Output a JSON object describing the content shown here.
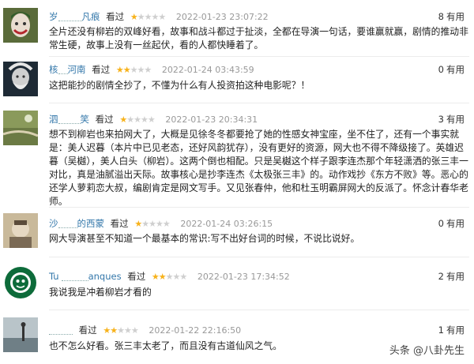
{
  "reviews": [
    {
      "user": "岁",
      "user_tail": "凡痕",
      "watched": "看过",
      "rating": 1,
      "date": "2022-01-23 23:07:22",
      "useful_count": "8",
      "useful_label": "有用",
      "text": "全片还没有柳岩的双峰好看，故事和战斗都过于扯淡，全都在导演一句话，要谁赢就赢，剧情的推动非常生硬，故事上没有一丝起伏，看的人都快睡着了。"
    },
    {
      "user": "核",
      "user_tail": "河南",
      "watched": "看过",
      "rating": 2,
      "date": "2022-01-24 03:43:59",
      "useful_count": "0",
      "useful_label": "有用",
      "text": "这把能抄的剧情全抄了，不懂为什么有人投资拍这种电影呢？！"
    },
    {
      "user": "泗",
      "user_tail": "笑",
      "watched": "看过",
      "rating": 1,
      "date": "2022-01-23 20:34:31",
      "useful_count": "3",
      "useful_label": "有用",
      "text": "想不到柳岩也来拍网大了，大概是见徐冬冬都要抢了她的性感女神宝座，坐不住了，还有一个事实就是：美人迟暮（本片中已见老态，还好风韵犹存），没有更好的资源，网大也不得不降级接了。英雄迟暮（吴樾），美人白头（柳岩）。这两个倒也相配。只是吴樾这个样子跟李连杰那个年轻潇洒的张三丰一对比，真是油腻溢出天际。故事核心是抄李连杰《太极张三丰》的。动作戏抄《东方不败》等。恶心的还学人萝莉恋大叔，编剧肯定是网文写手。又见张春仲，他和杜玉明霸屏网大的反派了。怀念计春华老师。"
    },
    {
      "user": "沙",
      "user_tail": "的西蒙",
      "watched": "看过",
      "rating": 1,
      "date": "2022-01-24 03:26:15",
      "useful_count": "0",
      "useful_label": "有用",
      "text": "网大导演甚至不知道一个最基本的常识:写不出好台词的时候，不说比说好。"
    },
    {
      "user": "Tu",
      "user_tail": "anques",
      "watched": "看过",
      "rating": 2,
      "date": "2022-01-23 17:34:52",
      "useful_count": "2",
      "useful_label": "有用",
      "text": "我说我是冲着柳岩才看的"
    },
    {
      "user": "",
      "user_tail": "",
      "watched": "看过",
      "rating": 2,
      "date": "2022-01-22 22:16:50",
      "useful_count": "1",
      "useful_label": "有用",
      "text": "也不怎么好看。张三丰太老了，而且没有古道仙风之气。"
    }
  ],
  "watermark": "头条 @八卦先生",
  "colors": {
    "star_on": "#f7b21b",
    "star_off": "#cfcfcf",
    "username": "#3377aa",
    "date": "#999999"
  }
}
